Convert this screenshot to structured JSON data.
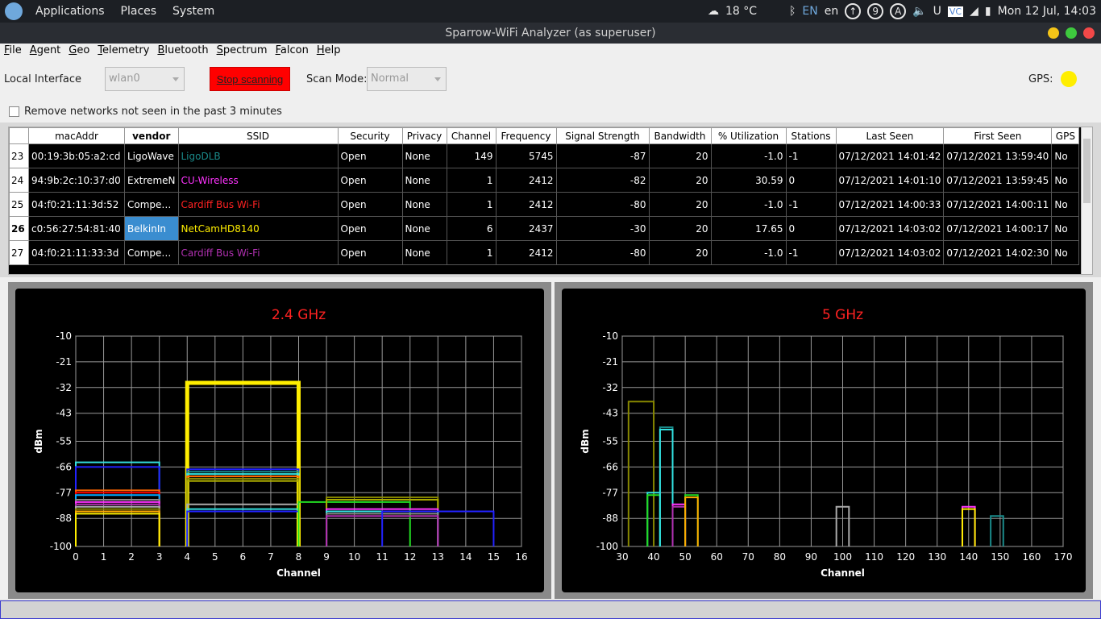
{
  "system_panel": {
    "menus": [
      "Applications",
      "Places",
      "System"
    ],
    "weather": "18 °C",
    "lang": "EN",
    "locale": "en",
    "circle_icons": [
      "↑",
      "9",
      "A"
    ],
    "clock": "Mon 12 Jul, 14:03"
  },
  "window": {
    "title": "Sparrow-WiFi Analyzer (as superuser)",
    "buttons": [
      {
        "name": "minimize",
        "color": "#f5c518"
      },
      {
        "name": "maximize",
        "color": "#3ec93e"
      },
      {
        "name": "close",
        "color": "#f24848"
      }
    ]
  },
  "menubar": [
    "File",
    "Agent",
    "Geo",
    "Telemetry",
    "Bluetooth",
    "Spectrum",
    "Falcon",
    "Help"
  ],
  "toolbar": {
    "local_interface_label": "Local Interface",
    "interface_value": "wlan0",
    "stop_button": "Stop scanning",
    "scan_mode_label": "Scan Mode:",
    "scan_mode_value": "Normal",
    "gps_label": "GPS:",
    "remove_label": "Remove networks not seen in the past 3 minutes"
  },
  "table": {
    "columns": [
      "macAddr",
      "vendor",
      "SSID",
      "Security",
      "Privacy",
      "Channel",
      "Frequency",
      "Signal Strength",
      "Bandwidth",
      "% Utilization",
      "Stations",
      "Last Seen",
      "First Seen",
      "GPS"
    ],
    "rows": [
      {
        "n": "23",
        "mac": "00:19:3b:05:a2:cd",
        "vendor": "LigoWave",
        "ssid": "LigoDLB",
        "ssid_color": "#1a8a8a",
        "security": "Open",
        "privacy": "None",
        "channel": "149",
        "freq": "5745",
        "signal": "-87",
        "bw": "20",
        "util": "-1.0",
        "stations": "-1",
        "last": "07/12/2021 14:01:42",
        "first": "07/12/2021 13:59:40",
        "gps": "No"
      },
      {
        "n": "24",
        "mac": "94:9b:2c:10:37:d0",
        "vendor": "ExtremeN",
        "ssid": "CU-Wireless",
        "ssid_color": "#ff33ff",
        "security": "Open",
        "privacy": "None",
        "channel": "1",
        "freq": "2412",
        "signal": "-82",
        "bw": "20",
        "util": "30.59",
        "stations": "0",
        "last": "07/12/2021 14:01:10",
        "first": "07/12/2021 13:59:45",
        "gps": "No"
      },
      {
        "n": "25",
        "mac": "04:f0:21:11:3d:52",
        "vendor": "Compe…",
        "ssid": "Cardiff Bus Wi-Fi",
        "ssid_color": "#ff2222",
        "security": "Open",
        "privacy": "None",
        "channel": "1",
        "freq": "2412",
        "signal": "-80",
        "bw": "20",
        "util": "-1.0",
        "stations": "-1",
        "last": "07/12/2021 14:00:33",
        "first": "07/12/2021 14:00:11",
        "gps": "No"
      },
      {
        "n": "26",
        "mac": "c0:56:27:54:81:40",
        "vendor": "BelkinIn",
        "ssid": "NetCamHD8140",
        "ssid_color": "#ffee00",
        "security": "Open",
        "privacy": "None",
        "channel": "6",
        "freq": "2437",
        "signal": "-30",
        "bw": "20",
        "util": "17.65",
        "stations": "0",
        "last": "07/12/2021 14:03:02",
        "first": "07/12/2021 14:00:17",
        "gps": "No",
        "selected": true
      },
      {
        "n": "27",
        "mac": "04:f0:21:11:33:3d",
        "vendor": "Compe…",
        "ssid": "Cardiff Bus Wi-Fi",
        "ssid_color": "#b030b0",
        "security": "Open",
        "privacy": "None",
        "channel": "1",
        "freq": "2412",
        "signal": "-80",
        "bw": "20",
        "util": "-1.0",
        "stations": "-1",
        "last": "07/12/2021 14:03:02",
        "first": "07/12/2021 14:02:30",
        "gps": "No"
      }
    ]
  },
  "chart_data": [
    {
      "type": "area",
      "title": "2.4 GHz",
      "xlabel": "Channel",
      "ylabel": "dBm",
      "xlim": [
        0,
        16
      ],
      "ylim": [
        -100,
        -10
      ],
      "xticks": [
        "0",
        "1",
        "2",
        "3",
        "4",
        "5",
        "6",
        "7",
        "8",
        "9",
        "10",
        "11",
        "12",
        "13",
        "14",
        "15",
        "16"
      ],
      "yticks": [
        "-10",
        "-21",
        "-32",
        "-43",
        "-55",
        "-66",
        "-77",
        "-88",
        "-100"
      ],
      "grid": true,
      "series": [
        {
          "x0": 0,
          "x1": 3,
          "y": -64,
          "color": "#33e0e0"
        },
        {
          "x0": 0,
          "x1": 3,
          "y": -66,
          "color": "#2222ff"
        },
        {
          "x0": 0,
          "x1": 3,
          "y": -76,
          "color": "#ff6600"
        },
        {
          "x0": 0,
          "x1": 3,
          "y": -77,
          "color": "#ff0000"
        },
        {
          "x0": 0,
          "x1": 3,
          "y": -78,
          "color": "#00aaff"
        },
        {
          "x0": 0,
          "x1": 3,
          "y": -80,
          "color": "#888888"
        },
        {
          "x0": 0,
          "x1": 3,
          "y": -81,
          "color": "#ff33ff"
        },
        {
          "x0": 0,
          "x1": 3,
          "y": -82,
          "color": "#b030b0"
        },
        {
          "x0": 0,
          "x1": 3,
          "y": -83,
          "color": "#aaaaaa"
        },
        {
          "x0": 0,
          "x1": 3,
          "y": -84,
          "color": "#888800"
        },
        {
          "x0": 0,
          "x1": 3,
          "y": -85,
          "color": "#ffaa00"
        },
        {
          "x0": 0,
          "x1": 3,
          "y": -86,
          "color": "#ffee00"
        },
        {
          "x0": 4,
          "x1": 8,
          "y": -30,
          "color": "#ffee00",
          "thick": true
        },
        {
          "x0": 4,
          "x1": 8,
          "y": -67,
          "color": "#2222ff"
        },
        {
          "x0": 4,
          "x1": 8,
          "y": -68,
          "color": "#1a8a8a"
        },
        {
          "x0": 4,
          "x1": 8,
          "y": -69,
          "color": "#33e0e0"
        },
        {
          "x0": 4,
          "x1": 8,
          "y": -70,
          "color": "#ff6600"
        },
        {
          "x0": 4,
          "x1": 8,
          "y": -71,
          "color": "#888800"
        },
        {
          "x0": 4,
          "x1": 8,
          "y": -72,
          "color": "#aaaa00"
        },
        {
          "x0": 4,
          "x1": 8,
          "y": -82,
          "color": "#aaaaaa"
        },
        {
          "x0": 4,
          "x1": 8,
          "y": -84,
          "color": "#33e0e0"
        },
        {
          "x0": 4,
          "x1": 8,
          "y": -85,
          "color": "#2222ff"
        },
        {
          "x0": 8,
          "x1": 12,
          "y": -81,
          "color": "#22dd22"
        },
        {
          "x0": 9,
          "x1": 13,
          "y": -79,
          "color": "#888800"
        },
        {
          "x0": 9,
          "x1": 13,
          "y": -80,
          "color": "#aaaa00"
        },
        {
          "x0": 9,
          "x1": 13,
          "y": -84,
          "color": "#ff33ff"
        },
        {
          "x0": 9,
          "x1": 13,
          "y": -85,
          "color": "#33e0e0"
        },
        {
          "x0": 9,
          "x1": 13,
          "y": -86,
          "color": "#888888"
        },
        {
          "x0": 9,
          "x1": 13,
          "y": -87,
          "color": "#b030b0"
        },
        {
          "x0": 11,
          "x1": 15,
          "y": -85,
          "color": "#2222ff"
        }
      ]
    },
    {
      "type": "area",
      "title": "5 GHz",
      "xlabel": "Channel",
      "ylabel": "dBm",
      "xlim": [
        30,
        170
      ],
      "ylim": [
        -100,
        -10
      ],
      "xticks": [
        "30",
        "40",
        "50",
        "60",
        "70",
        "80",
        "90",
        "100",
        "110",
        "120",
        "130",
        "140",
        "150",
        "160",
        "170"
      ],
      "yticks": [
        "-10",
        "-21",
        "-32",
        "-43",
        "-55",
        "-66",
        "-77",
        "-88",
        "-100"
      ],
      "grid": true,
      "series": [
        {
          "x0": 32,
          "x1": 40,
          "y": -38,
          "color": "#888800"
        },
        {
          "x0": 38,
          "x1": 42,
          "y": -77,
          "color": "#33e0e0"
        },
        {
          "x0": 38,
          "x1": 42,
          "y": -78,
          "color": "#22dd22"
        },
        {
          "x0": 42,
          "x1": 46,
          "y": -49,
          "color": "#1a8a8a"
        },
        {
          "x0": 42,
          "x1": 46,
          "y": -50,
          "color": "#33e0e0"
        },
        {
          "x0": 46,
          "x1": 50,
          "y": -82,
          "color": "#ff33ff"
        },
        {
          "x0": 46,
          "x1": 50,
          "y": -83,
          "color": "#b030b0"
        },
        {
          "x0": 50,
          "x1": 54,
          "y": -78,
          "color": "#22dd22"
        },
        {
          "x0": 50,
          "x1": 54,
          "y": -79,
          "color": "#ffaa00"
        },
        {
          "x0": 98,
          "x1": 102,
          "y": -83,
          "color": "#aaaaaa"
        },
        {
          "x0": 138,
          "x1": 142,
          "y": -83,
          "color": "#ff33ff"
        },
        {
          "x0": 138,
          "x1": 142,
          "y": -84,
          "color": "#ffee00"
        },
        {
          "x0": 147,
          "x1": 151,
          "y": -87,
          "color": "#1a8a8a"
        }
      ]
    }
  ]
}
